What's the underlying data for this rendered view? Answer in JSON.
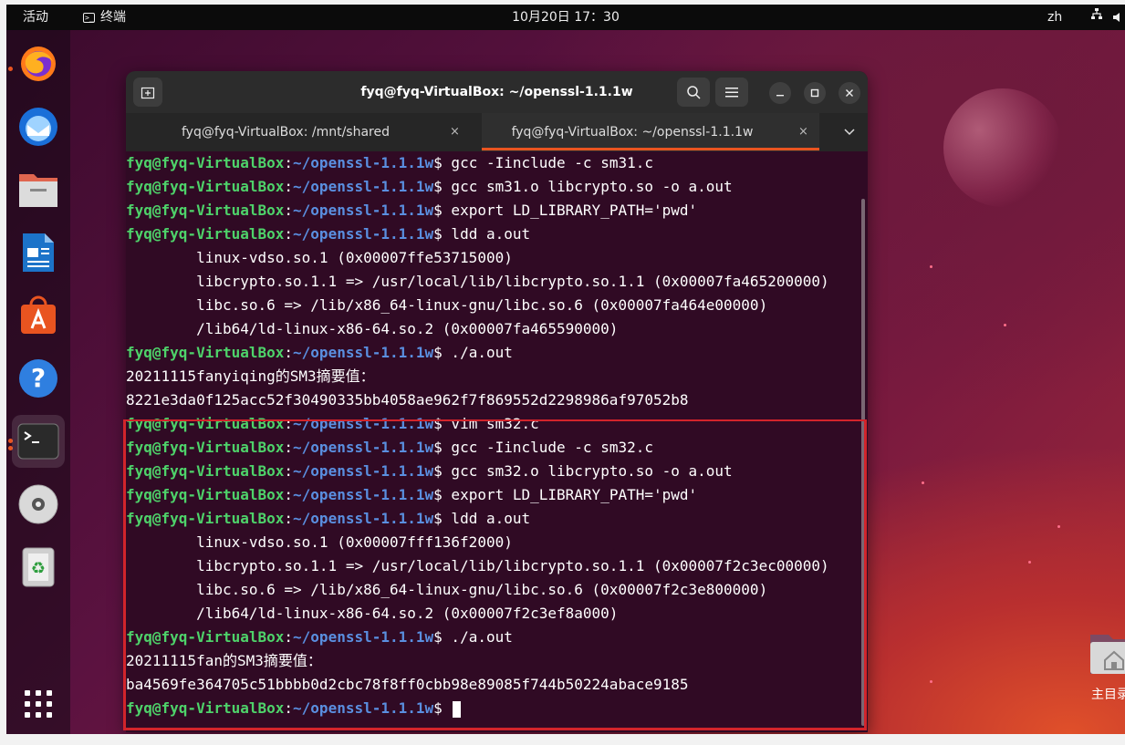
{
  "topbar": {
    "activities": "活动",
    "app_name": "终端",
    "clock": "10月20日 17：30",
    "language": "zh"
  },
  "dock": {
    "items": [
      {
        "name": "firefox-icon"
      },
      {
        "name": "thunderbird-icon"
      },
      {
        "name": "files-icon"
      },
      {
        "name": "libreoffice-writer-icon"
      },
      {
        "name": "app-center-icon"
      },
      {
        "name": "help-icon"
      },
      {
        "name": "terminal-icon"
      },
      {
        "name": "dvd-icon"
      },
      {
        "name": "trash-icon"
      },
      {
        "name": "show-apps-icon"
      }
    ]
  },
  "desktop": {
    "home_label": "主目录"
  },
  "window": {
    "title": "fyq@fyq-VirtualBox: ~/openssl-1.1.1w",
    "tabs": [
      {
        "label": "fyq@fyq-VirtualBox: /mnt/shared",
        "close": "×"
      },
      {
        "label": "fyq@fyq-VirtualBox: ~/openssl-1.1.1w",
        "close": "×"
      }
    ],
    "tab_overflow": "⌄",
    "buttons": {
      "new_tab": "+",
      "search": "⌕",
      "menu": "≡",
      "minimize": "–",
      "maximize": "□",
      "close": "×"
    }
  },
  "terminal": {
    "user": "fyq@fyq-VirtualBox",
    "path": "~/openssl-1.1.1w",
    "lines": [
      {
        "type": "prompt",
        "cmd": " gcc -Iinclude -c sm31.c"
      },
      {
        "type": "prompt",
        "cmd": " gcc sm31.o libcrypto.so -o a.out"
      },
      {
        "type": "prompt",
        "cmd": " export LD_LIBRARY_PATH='pwd'"
      },
      {
        "type": "prompt",
        "cmd": " ldd a.out"
      },
      {
        "type": "output",
        "text": "        linux-vdso.so.1 (0x00007ffe53715000)"
      },
      {
        "type": "output",
        "text": "        libcrypto.so.1.1 => /usr/local/lib/libcrypto.so.1.1 (0x00007fa465200000)"
      },
      {
        "type": "output",
        "text": "        libc.so.6 => /lib/x86_64-linux-gnu/libc.so.6 (0x00007fa464e00000)"
      },
      {
        "type": "output",
        "text": "        /lib64/ld-linux-x86-64.so.2 (0x00007fa465590000)"
      },
      {
        "type": "prompt",
        "cmd": " ./a.out"
      },
      {
        "type": "output",
        "text": "20211115fanyiqing的SM3摘要值："
      },
      {
        "type": "output",
        "text": "8221e3da0f125acc52f30490335bb4058ae962f7f869552d2298986af97052b8"
      },
      {
        "type": "prompt",
        "cmd": " vim sm32.c"
      },
      {
        "type": "prompt",
        "cmd": " gcc -Iinclude -c sm32.c"
      },
      {
        "type": "prompt",
        "cmd": " gcc sm32.o libcrypto.so -o a.out"
      },
      {
        "type": "prompt",
        "cmd": " export LD_LIBRARY_PATH='pwd'"
      },
      {
        "type": "prompt",
        "cmd": " ldd a.out"
      },
      {
        "type": "output",
        "text": "        linux-vdso.so.1 (0x00007fff136f2000)"
      },
      {
        "type": "output",
        "text": "        libcrypto.so.1.1 => /usr/local/lib/libcrypto.so.1.1 (0x00007f2c3ec00000)"
      },
      {
        "type": "output",
        "text": "        libc.so.6 => /lib/x86_64-linux-gnu/libc.so.6 (0x00007f2c3e800000)"
      },
      {
        "type": "output",
        "text": "        /lib64/ld-linux-x86-64.so.2 (0x00007f2c3ef8a000)"
      },
      {
        "type": "prompt",
        "cmd": " ./a.out"
      },
      {
        "type": "output",
        "text": "20211115fan的SM3摘要值："
      },
      {
        "type": "output",
        "text": "ba4569fe364705c51bbbb0d2cbc78f8ff0cbb98e89085f744b50224abace9185"
      },
      {
        "type": "prompt",
        "cmd": " "
      }
    ]
  },
  "colors": {
    "terminal_bg": "#300a24",
    "user_color": "#4ed36a",
    "path_color": "#5a8fe0",
    "accent": "#e95420",
    "highlight_box": "#d2242b"
  }
}
